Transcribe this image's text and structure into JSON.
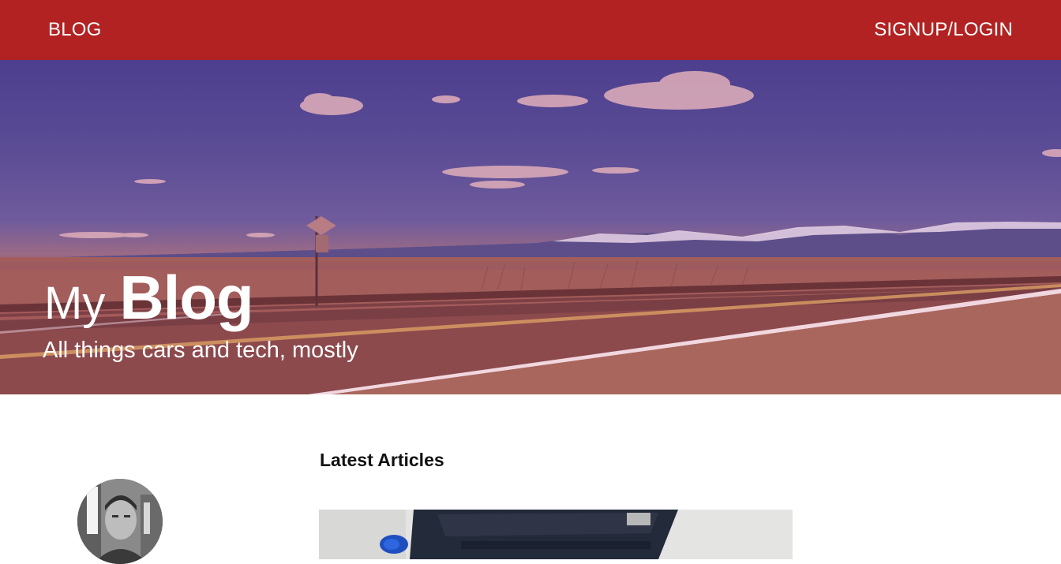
{
  "nav": {
    "blog_label": "BLOG",
    "login_label": "SIGNUP/LOGIN"
  },
  "hero": {
    "title_small": "My",
    "title_large": "Blog",
    "subtitle": "All things cars and tech, mostly",
    "image_subject": "highway through open plains with snowy mountains"
  },
  "content": {
    "latest_heading": "Latest Articles"
  },
  "author": {
    "avatar_subject": "author portrait photo"
  },
  "colors": {
    "nav_background": "#b22222",
    "text_on_dark": "#ffffff",
    "heading_text": "#111111"
  }
}
